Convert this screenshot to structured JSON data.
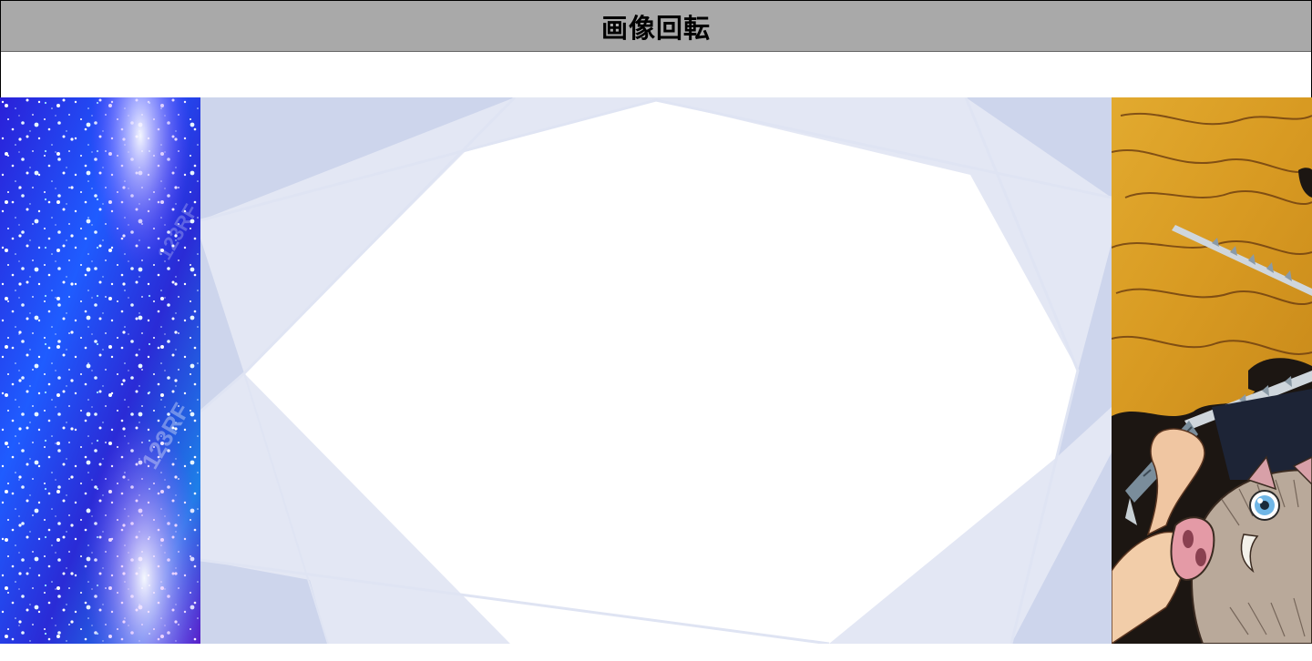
{
  "header": {
    "title": "画像回転"
  },
  "slides": [
    {
      "name": "galaxy-sparkle-image",
      "watermark": "123RF"
    },
    {
      "name": "blue-geometric-frame"
    },
    {
      "name": "anime-character-boar-mask"
    }
  ],
  "colors": {
    "header_bg": "#a9a9a9",
    "frame_blue": "#cdd5ec",
    "frame_blue_light": "#e3e7f4",
    "gold": "#d9a030",
    "galaxy_blue": "#1a3cff"
  }
}
